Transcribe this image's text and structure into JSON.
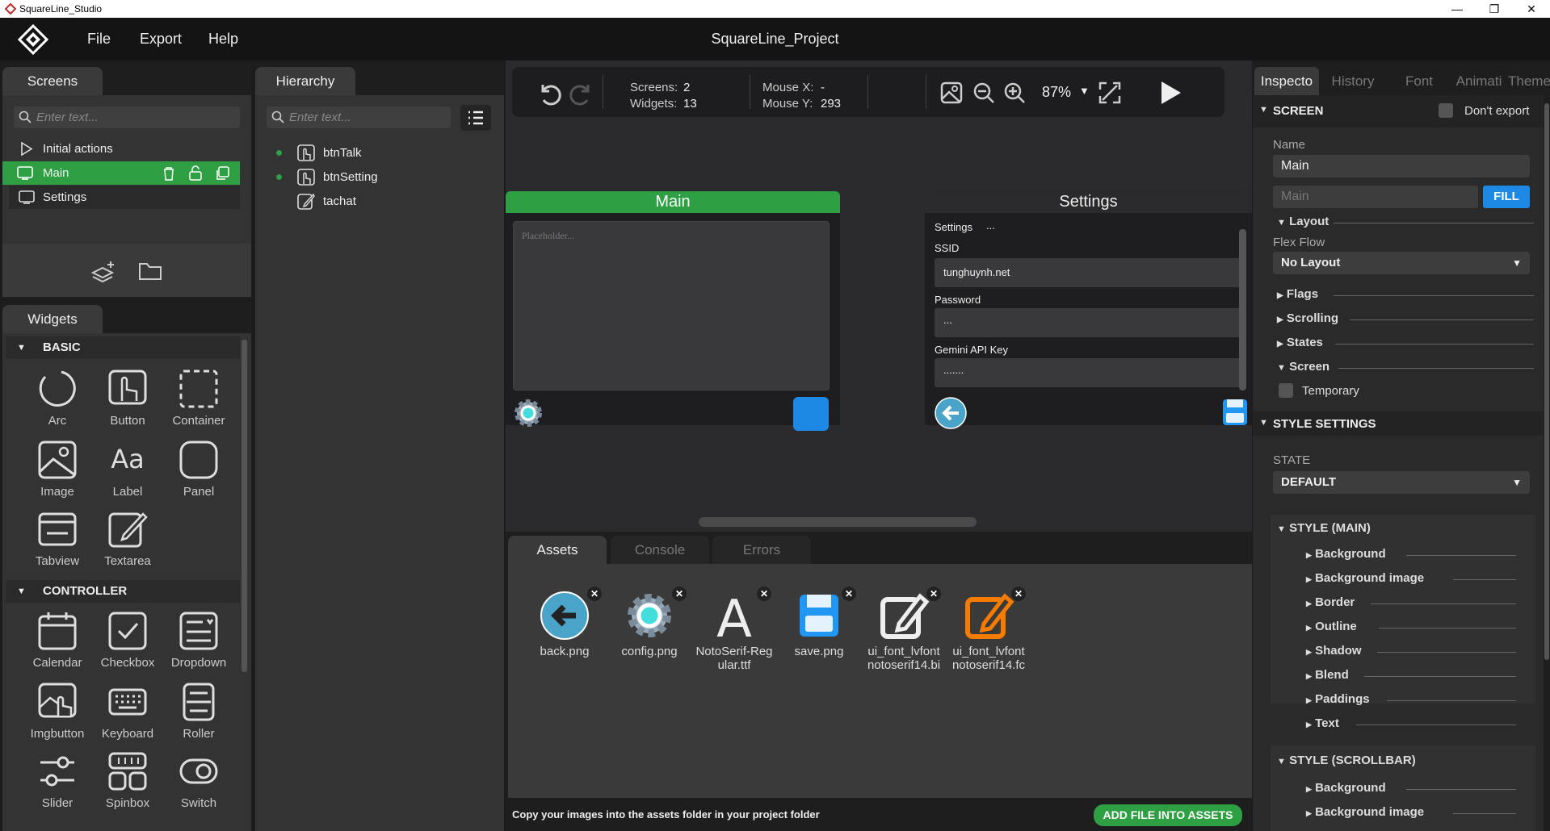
{
  "window": {
    "title": "SquareLine_Studio",
    "controls": [
      "—",
      "❐",
      "✕"
    ]
  },
  "menu": {
    "items": [
      "File",
      "Export",
      "Help"
    ],
    "project_title": "SquareLine_Project"
  },
  "screens_panel": {
    "tab": "Screens",
    "search_placeholder": "Enter text...",
    "items": [
      {
        "label": "Initial actions"
      },
      {
        "label": "Main"
      },
      {
        "label": "Settings"
      }
    ]
  },
  "hierarchy_panel": {
    "tab": "Hierarchy",
    "search_placeholder": "Enter text...",
    "items": [
      {
        "label": "btnTalk"
      },
      {
        "label": "btnSetting"
      },
      {
        "label": "tachat"
      }
    ]
  },
  "widgets_panel": {
    "tab": "Widgets",
    "sections": [
      {
        "title": "BASIC",
        "items": [
          "Arc",
          "Button",
          "Container",
          "Image",
          "Label",
          "Panel",
          "Tabview",
          "Textarea"
        ]
      },
      {
        "title": "CONTROLLER",
        "items": [
          "Calendar",
          "Checkbox",
          "Dropdown",
          "Imgbutton",
          "Keyboard",
          "Roller",
          "Slider",
          "Spinbox",
          "Switch"
        ]
      }
    ]
  },
  "toolbar": {
    "screens_label": "Screens:",
    "screens_value": "2",
    "widgets_label": "Widgets:",
    "widgets_value": "13",
    "mousex_label": "Mouse X:",
    "mousex_value": "-",
    "mousey_label": "Mouse Y:",
    "mousey_value": "293",
    "zoom": "87%"
  },
  "canvas": {
    "main_screen": {
      "title": "Main",
      "textarea_placeholder": "Placeholder..."
    },
    "settings_screen": {
      "title": "Settings",
      "heading": "Settings",
      "heading_dots": "...",
      "ssid_label": "SSID",
      "ssid_value": "tunghuynh.net",
      "password_label": "Password",
      "password_value": "...",
      "api_label": "Gemini API Key",
      "api_value": "......."
    }
  },
  "bottom_panel": {
    "tabs": [
      "Assets",
      "Console",
      "Errors"
    ],
    "assets": [
      {
        "name": "back.png"
      },
      {
        "name": "config.png"
      },
      {
        "name": "NotoSerif-Regular.ttf",
        "line1": "NotoSerif-Reg",
        "line2": "ular.ttf"
      },
      {
        "name": "save.png"
      },
      {
        "name": "ui_font_lvfontnotoserif14.bi",
        "line1": "ui_font_lvfont",
        "line2": "notoserif14.bi"
      },
      {
        "name": "ui_font_lvfontnotoserif14.fc",
        "line1": "ui_font_lvfont",
        "line2": "notoserif14.fc"
      }
    ],
    "hint": "Copy your images into the assets folder in your project folder",
    "add_button": "ADD FILE INTO ASSETS"
  },
  "inspector": {
    "tabs": [
      "Inspecto",
      "History",
      "Font",
      "Animati",
      "Themes"
    ],
    "screen_header": "SCREEN",
    "dont_export": "Don't export",
    "name_label": "Name",
    "name_value": "Main",
    "fill_input": "Main",
    "fill_button": "FILL",
    "layout_header": "Layout",
    "flex_label": "Flex Flow",
    "flex_value": "No Layout",
    "groups": [
      "Flags",
      "Scrolling",
      "States",
      "Screen"
    ],
    "temporary": "Temporary",
    "style_settings": "STYLE SETTINGS",
    "state_label": "STATE",
    "state_value": "DEFAULT",
    "style_main": "STYLE (MAIN)",
    "style_main_items": [
      "Background",
      "Background image",
      "Border",
      "Outline",
      "Shadow",
      "Blend",
      "Paddings",
      "Text"
    ],
    "style_scrollbar": "STYLE (SCROLLBAR)",
    "style_scrollbar_items": [
      "Background",
      "Background image"
    ]
  },
  "colors": {
    "accent_green": "#2ea043",
    "fill_blue": "#1e88e5",
    "asset_orange": "#f57c00"
  }
}
